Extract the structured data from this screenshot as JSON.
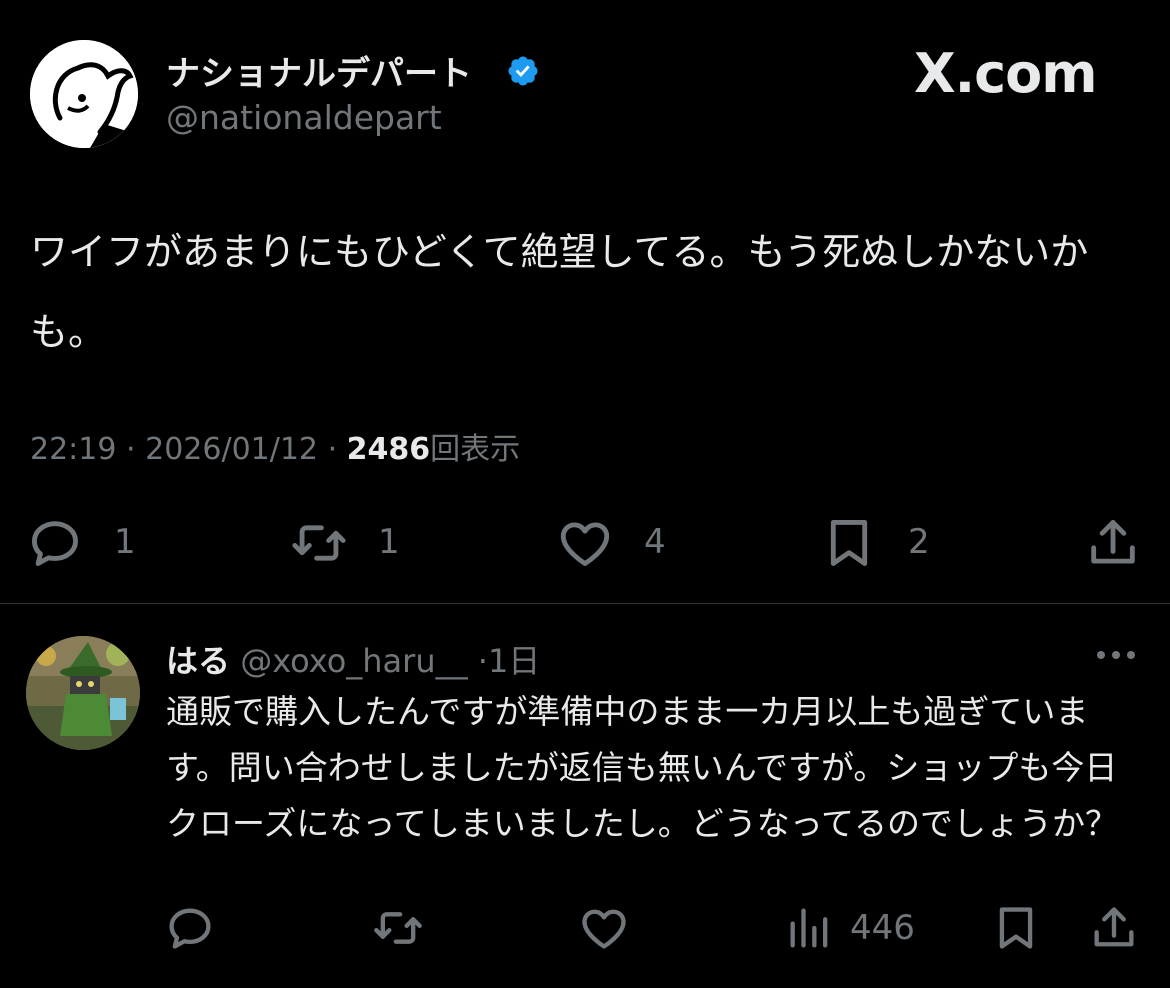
{
  "main_tweet": {
    "display_name": "ナショナルデパート",
    "handle": "@nationaldepart",
    "brand": "X.com",
    "text": "ワイフがあまりにもひどくて絶望してる。もう死ぬしかないかも。",
    "time": "22:19",
    "date": "2026/01/12",
    "views_count": "2486",
    "views_label": "回表示",
    "separator": "·",
    "actions": {
      "reply_count": "1",
      "retweet_count": "1",
      "like_count": "4",
      "bookmark_count": "2"
    },
    "icons": [
      "verified-badge-icon",
      "reply-icon",
      "retweet-icon",
      "like-icon",
      "bookmark-icon",
      "share-icon"
    ],
    "colors": {
      "verified": "#1d9bf0",
      "background": "#000000",
      "muted": "#71767b",
      "text": "#e7e9ea"
    }
  },
  "reply": {
    "display_name": "はる",
    "handle": "@xoxo_haru__",
    "separator": "·",
    "time": "1日",
    "text": "通販で購入したんですが準備中のまま一カ月以上も過ぎています。問い合わせしましたが返信も無いんですが。ショップも今日クローズになってしまいましたし。どうなってるのでしょうか？",
    "views_count": "446",
    "icons": [
      "reply-icon",
      "retweet-icon",
      "like-icon",
      "views-icon",
      "bookmark-icon",
      "share-icon",
      "more-icon"
    ]
  }
}
